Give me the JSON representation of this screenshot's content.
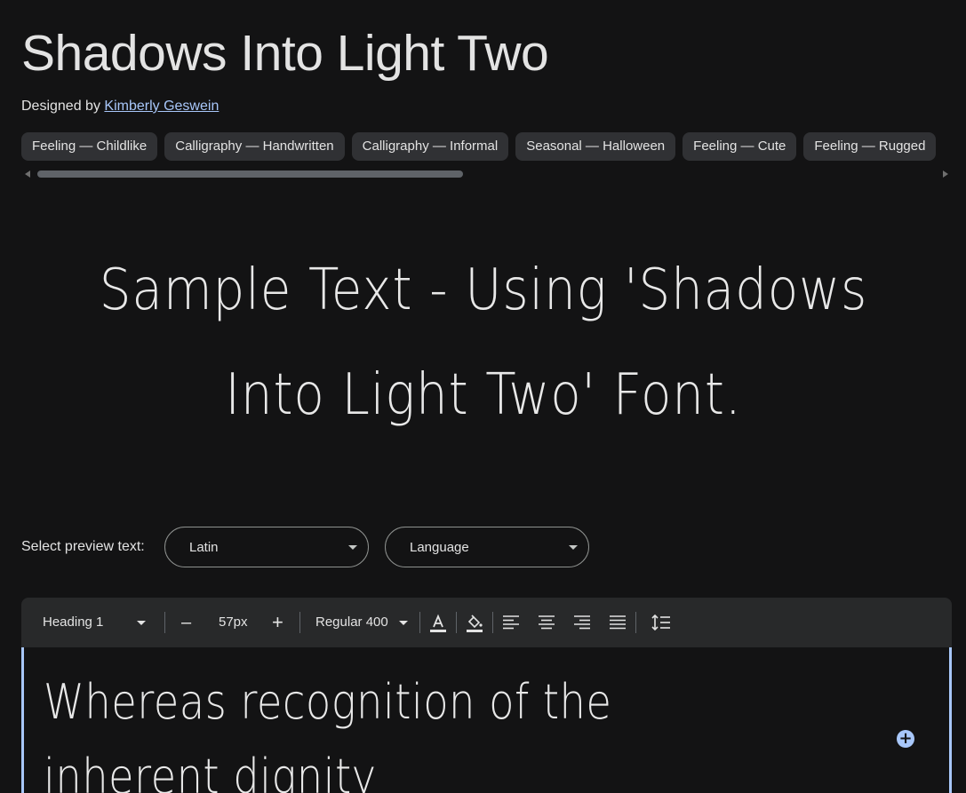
{
  "header": {
    "title": "Shadows Into Light Two",
    "designed_by_label": "Designed by",
    "designer_name": "Kimberly Geswein"
  },
  "tags": [
    "Feeling — Childlike",
    "Calligraphy — Handwritten",
    "Calligraphy — Informal",
    "Seasonal — Halloween",
    "Feeling — Cute",
    "Feeling — Rugged"
  ],
  "sample": {
    "line1": "Sample Text - Using 'Shadows",
    "line2": "Into Light Two' Font."
  },
  "preview": {
    "label": "Select preview text:",
    "script_select": "Latin",
    "language_select": "Language"
  },
  "toolbar": {
    "style_select": "Heading 1",
    "decrease": "–",
    "size_value": "57px",
    "increase": "+",
    "weight_select": "Regular 400"
  },
  "editor": {
    "text": "Whereas recognition of the inherent dignity"
  },
  "colors": {
    "background": "#131314",
    "chip": "#303134",
    "toolbar": "#28292a",
    "accent": "#a8c7fa"
  },
  "icons": [
    "text-color-icon",
    "highlight-color-icon",
    "align-left-icon",
    "align-center-icon",
    "align-right-icon",
    "align-justify-icon",
    "line-height-icon",
    "add-circle-icon"
  ]
}
